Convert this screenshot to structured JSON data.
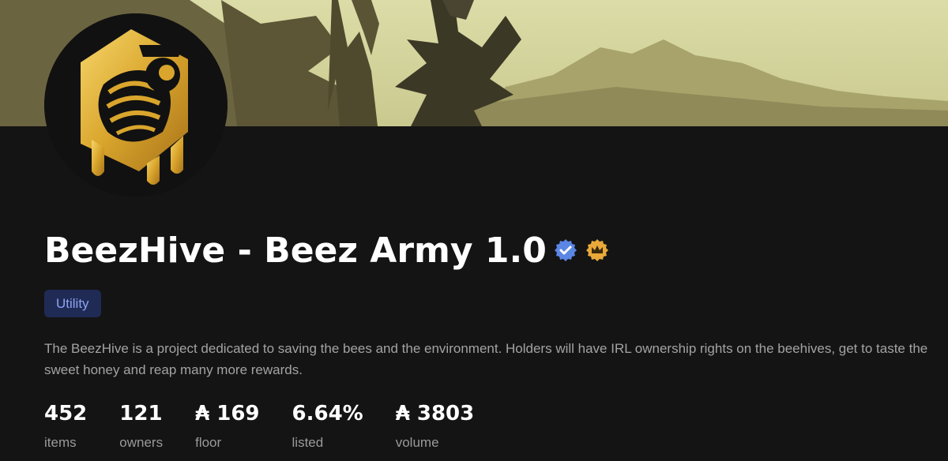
{
  "collection": {
    "name": "BeezHive - Beez Army 1.0",
    "badges": [
      "verified-badge-icon",
      "crown-badge-icon"
    ],
    "tag": "Utility",
    "description": "The BeezHive is a project dedicated to saving the bees and the environment. Holders will have IRL ownership rights on the beehives, get to taste the sweet honey and reap many more rewards."
  },
  "stats": [
    {
      "value": "452",
      "label": "items"
    },
    {
      "value": "121",
      "label": "owners"
    },
    {
      "value": "₳ 169",
      "label": "floor"
    },
    {
      "value": "6.64%",
      "label": "listed"
    },
    {
      "value": "₳ 3803",
      "label": "volume"
    }
  ],
  "colors": {
    "background": "#141414",
    "tag_bg": "#1f2b55",
    "tag_text": "#8ea2f3",
    "verified": "#5b86e5",
    "crown": "#e8a93a",
    "logo_gold": "#d9a52c"
  }
}
